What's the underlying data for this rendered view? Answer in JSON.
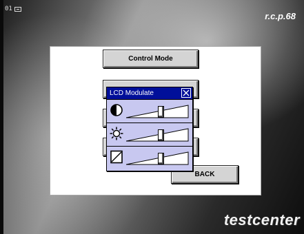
{
  "status": {
    "page_number": "01"
  },
  "brand": {
    "code": "r.c.p.68",
    "logo": "testcenter"
  },
  "buttons": {
    "control_mode": "Control Mode",
    "back": "BACK"
  },
  "dialog": {
    "title": "LCD Modulate",
    "close_icon": "close-icon",
    "sliders": [
      {
        "icon": "contrast-icon",
        "level": 0.55
      },
      {
        "icon": "brightness-icon",
        "level": 0.55
      },
      {
        "icon": "backlight-icon",
        "level": 0.55
      }
    ]
  },
  "colors": {
    "titlebar": "#000f9a",
    "dialog_bg": "#c8c8f0",
    "button": "#d4d4d4"
  }
}
